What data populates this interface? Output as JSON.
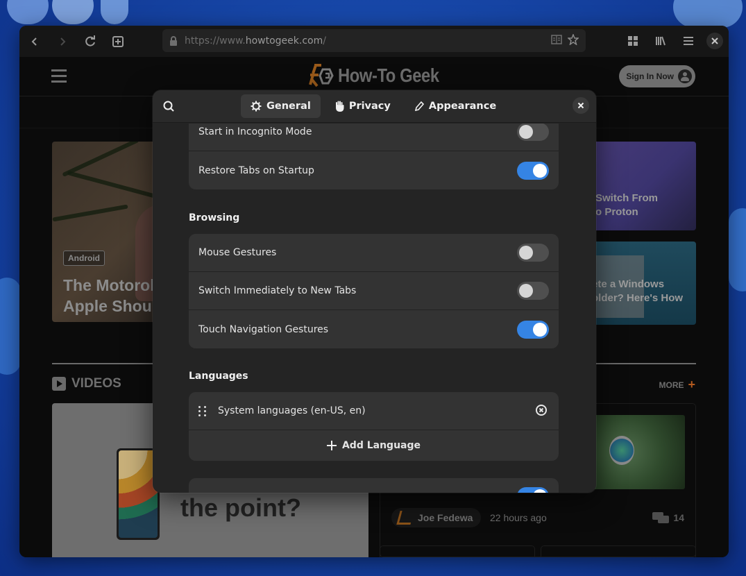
{
  "browser": {
    "url_prefix": "https://www.",
    "url_domain": "howtogeek.com",
    "url_suffix": "/",
    "toolbar_icons": [
      "back-icon",
      "forward-icon",
      "reload-icon",
      "new-tab-icon",
      "lock-icon",
      "reader-mode-icon",
      "bookmark-star-icon",
      "extensions-grid-icon",
      "library-icon",
      "menu-icon",
      "close-icon"
    ]
  },
  "site": {
    "logo_text": "How-To Geek",
    "sign_in_label": "Sign In Now",
    "hero": {
      "tag": "Android",
      "title_line1": "The Motorol",
      "title_line2": "Apple Shoul"
    },
    "side_cards": [
      {
        "line1": "Switch From",
        "line2": "o Proton"
      },
      {
        "line1": "ete a Windows",
        "line2": "older? Here's How"
      }
    ],
    "videos_label": "VIDEOS",
    "more_label": "MORE",
    "video_overlay_text": "the point?",
    "article": {
      "author": "Joe Fedewa",
      "time_ago": "22 hours ago",
      "comment_count": "14"
    }
  },
  "preferences": {
    "tabs": [
      {
        "label": "General",
        "icon": "gear-icon",
        "active": true
      },
      {
        "label": "Privacy",
        "icon": "hand-icon",
        "active": false
      },
      {
        "label": "Appearance",
        "icon": "pencil-icon",
        "active": false
      }
    ],
    "startup_rows": [
      {
        "label": "Start in Incognito Mode",
        "enabled": false
      },
      {
        "label": "Restore Tabs on Startup",
        "enabled": true
      }
    ],
    "browsing": {
      "title": "Browsing",
      "rows": [
        {
          "label": "Mouse Gestures",
          "enabled": false
        },
        {
          "label": "Switch Immediately to New Tabs",
          "enabled": false
        },
        {
          "label": "Touch Navigation Gestures",
          "enabled": true
        }
      ]
    },
    "languages": {
      "title": "Languages",
      "items": [
        "System languages (en-US, en)"
      ],
      "add_label": "Add Language"
    },
    "next_row_enabled": true
  }
}
